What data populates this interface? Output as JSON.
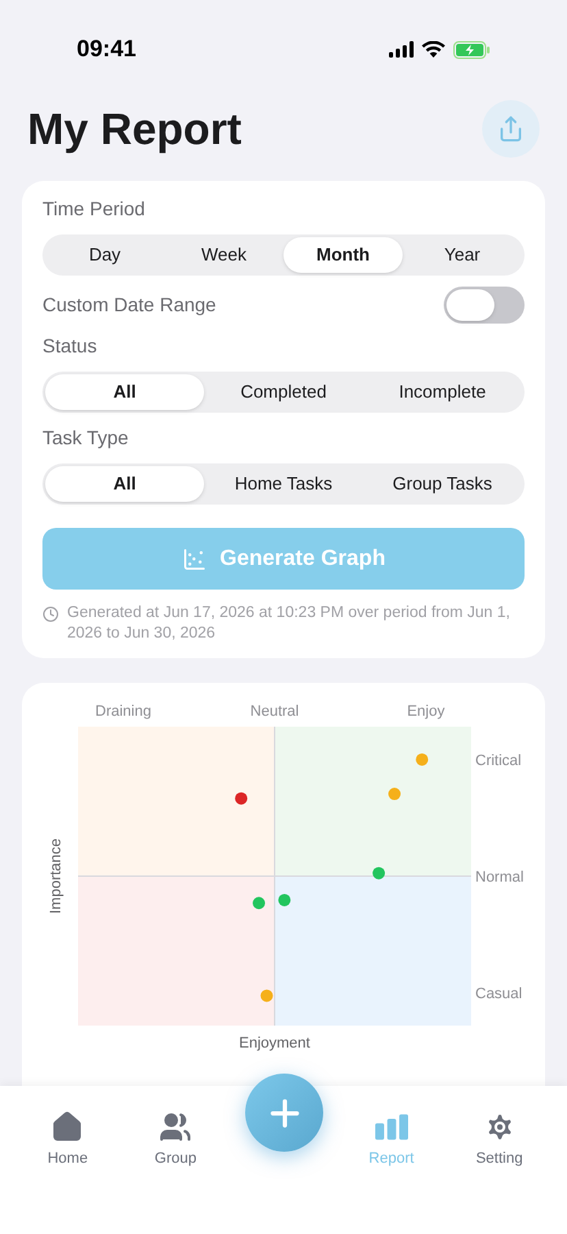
{
  "status_bar": {
    "time": "09:41"
  },
  "header": {
    "title": "My Report"
  },
  "filters": {
    "time_period": {
      "label": "Time Period",
      "options": [
        {
          "label": "Day",
          "selected": false
        },
        {
          "label": "Week",
          "selected": false
        },
        {
          "label": "Month",
          "selected": true
        },
        {
          "label": "Year",
          "selected": false
        }
      ]
    },
    "custom_range": {
      "label": "Custom Date Range",
      "on": false
    },
    "status": {
      "label": "Status",
      "options": [
        {
          "label": "All",
          "selected": true
        },
        {
          "label": "Completed",
          "selected": false
        },
        {
          "label": "Incomplete",
          "selected": false
        }
      ]
    },
    "task_type": {
      "label": "Task Type",
      "options": [
        {
          "label": "All",
          "selected": true
        },
        {
          "label": "Home Tasks",
          "selected": false
        },
        {
          "label": "Group Tasks",
          "selected": false
        }
      ]
    },
    "generate_button": "Generate Graph",
    "note": "Generated at Jun 17, 2026 at 10:23 PM over period from Jun 1, 2026 to Jun 30, 2026"
  },
  "chart": {
    "xlabel": "Enjoyment",
    "ylabel": "Importance",
    "top_labels": [
      "Draining",
      "Neutral",
      "Enjoy"
    ],
    "side_labels": [
      "Critical",
      "Normal",
      "Casual"
    ]
  },
  "tab_bar": {
    "items": [
      {
        "label": "Home",
        "kind": "home",
        "selected": false
      },
      {
        "label": "Group",
        "kind": "group",
        "selected": false
      },
      {
        "label": "Report",
        "kind": "report",
        "selected": true
      },
      {
        "label": "Setting",
        "kind": "setting",
        "selected": false
      }
    ]
  }
}
